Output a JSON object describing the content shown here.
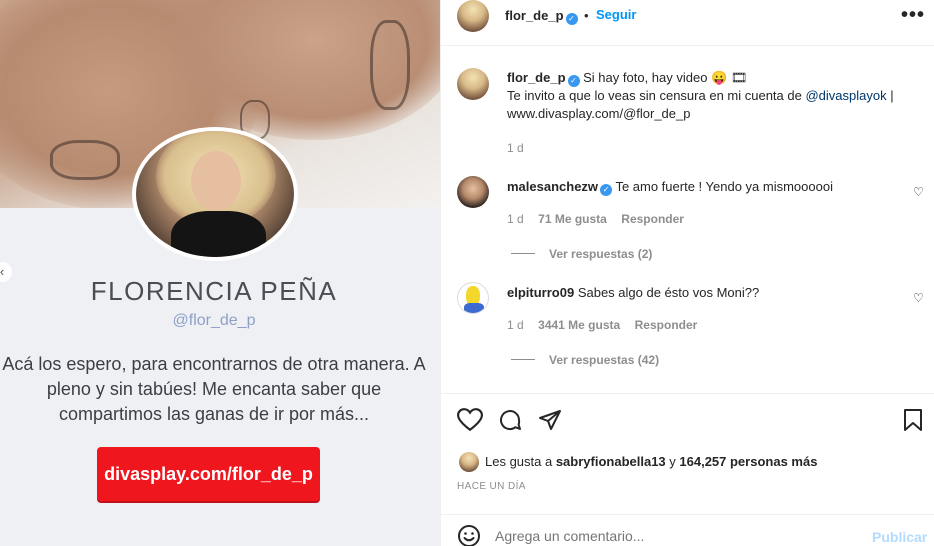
{
  "media": {
    "profile_name": "FLORENCIA PEÑA",
    "profile_handle": "@flor_de_p",
    "bio": "Acá los espero, para encontrarnos de otra manera. A pleno y sin tabúes! Me encanta saber que compartimos las ganas de ir por más...",
    "cta_label": "divasplay.com/flor_de_p",
    "prev_icon": "chevron-left-icon"
  },
  "header": {
    "username": "flor_de_p",
    "separator": "•",
    "follow_label": "Seguir",
    "more_icon": "•••"
  },
  "caption": {
    "username": "flor_de_p",
    "text_line1": "Si hay foto, hay video 😛 🎞",
    "text_line2_prefix": "Te invito a que lo veas sin censura en mi cuenta de ",
    "mention": "@divasplayok",
    "text_line2_suffix": " |",
    "text_line3": "www.divasplay.com/@flor_de_p",
    "time": "1 d"
  },
  "comments": [
    {
      "username": "malesanchezw",
      "verified": true,
      "text": "Te amo fuerte ! Yendo ya mismoooooi",
      "time": "1 d",
      "likes": "71 Me gusta",
      "reply": "Responder",
      "replies": "Ver respuestas (2)"
    },
    {
      "username": "elpiturro09",
      "verified": false,
      "text": "Sabes algo de ésto vos Moni??",
      "time": "1 d",
      "likes": "3441 Me gusta",
      "reply": "Responder",
      "replies": "Ver respuestas (42)"
    }
  ],
  "likes": {
    "prefix": "Les gusta a ",
    "user": "sabryfionabella13",
    "mid": " y ",
    "count": "164,257 personas más"
  },
  "time_ago": "HACE UN DÍA",
  "add_comment": {
    "placeholder": "Agrega un comentario...",
    "publish_label": "Publicar"
  },
  "colors": {
    "accent": "#0095f6",
    "cta": "#f0161e",
    "muted": "#8e8e8e"
  }
}
